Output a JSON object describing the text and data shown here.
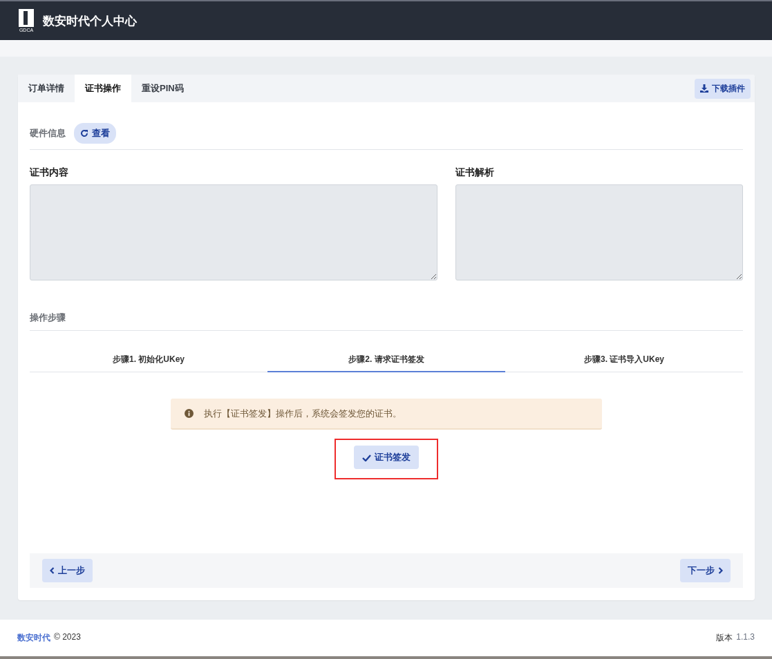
{
  "header": {
    "logo_text": "GDCA",
    "title": "数安时代个人中心"
  },
  "tabs": [
    {
      "label": "订单详情",
      "selected": false
    },
    {
      "label": "证书操作",
      "selected": true
    },
    {
      "label": "重设PIN码",
      "selected": false
    }
  ],
  "download_button": "下载插件",
  "hardware": {
    "label": "硬件信息",
    "button": "查看"
  },
  "panels": [
    {
      "title": "证书内容"
    },
    {
      "title": "证书解析"
    }
  ],
  "steps_label": "操作步骤",
  "steps": [
    {
      "label": "步骤1. 初始化UKey",
      "selected": false
    },
    {
      "label": "步骤2. 请求证书签发",
      "selected": true
    },
    {
      "label": "步骤3. 证书导入UKey",
      "selected": false
    }
  ],
  "alert": "执行【证书签发】操作后，系统会签发您的证书。",
  "action_button": {
    "label": "证书签发",
    "highlighted": true
  },
  "nav": {
    "prev": "上一步",
    "next": "下一步"
  },
  "footer": {
    "brand": "数安时代",
    "copyright": "© 2023",
    "version_label": "版本",
    "version": "1.1.3"
  }
}
